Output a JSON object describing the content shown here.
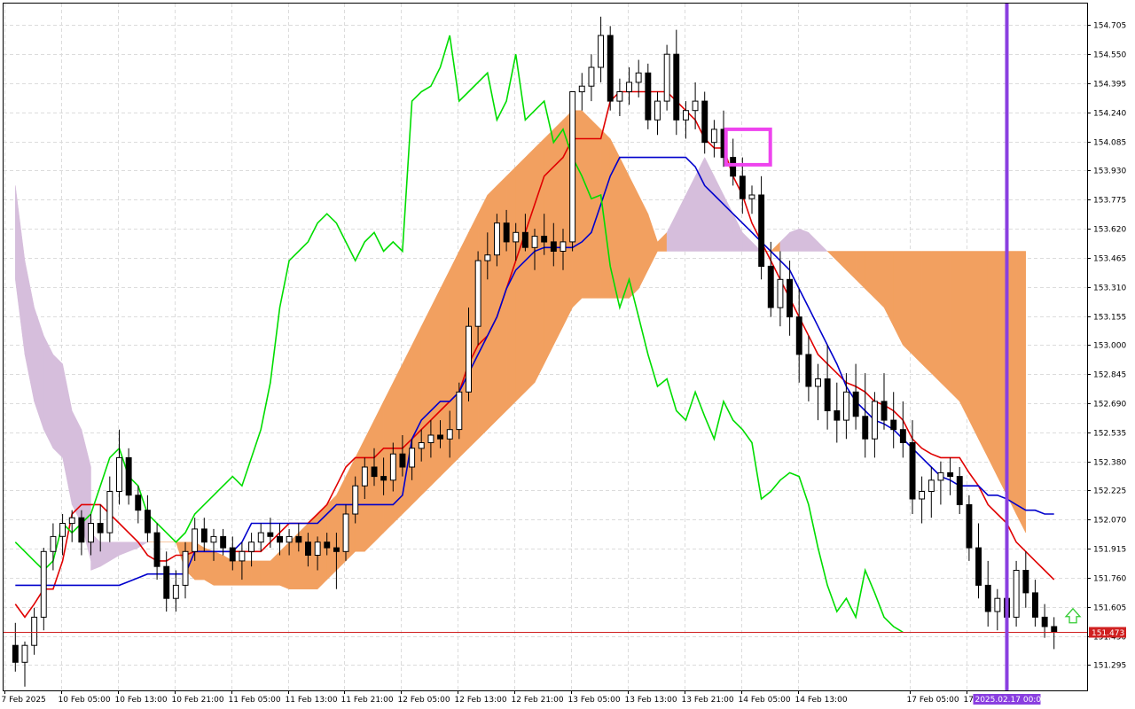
{
  "chart_data": {
    "type": "candlestick",
    "indicator": "Ichimoku Kinko Hyo",
    "grid": true,
    "ylim": [
      151.16,
      154.82
    ],
    "y_ticks": [
      "154.705",
      "154.550",
      "154.395",
      "154.240",
      "154.085",
      "153.930",
      "153.775",
      "153.620",
      "153.465",
      "153.310",
      "153.155",
      "153.000",
      "152.845",
      "152.690",
      "152.535",
      "152.380",
      "152.225",
      "152.070",
      "151.915",
      "151.760",
      "151.605",
      "151.450",
      "151.295"
    ],
    "x_ticks": [
      "7 Feb 2025",
      "10 Feb 05:00",
      "10 Feb 13:00",
      "10 Feb 21:00",
      "11 Feb 05:00",
      "11 Feb 13:00",
      "11 Feb 21:00",
      "12 Feb 05:00",
      "12 Feb 13:00",
      "12 Feb 21:00",
      "13 Feb 05:00",
      "13 Feb 13:00",
      "13 Feb 21:00",
      "14 Feb 05:00",
      "14 Feb 13:00",
      "17 Feb 05:00",
      "17 Feb 13:00"
    ],
    "current_price": "151.473",
    "vline_label": "2025.02.17 00:00",
    "ohlc": [
      [
        151.4,
        151.52,
        151.26,
        151.31
      ],
      [
        151.31,
        151.42,
        151.18,
        151.4
      ],
      [
        151.4,
        151.6,
        151.35,
        151.55
      ],
      [
        151.55,
        151.92,
        151.48,
        151.9
      ],
      [
        151.9,
        152.05,
        151.8,
        151.98
      ],
      [
        151.98,
        152.1,
        151.88,
        152.05
      ],
      [
        152.05,
        152.12,
        151.95,
        152.08
      ],
      [
        152.08,
        152.12,
        151.88,
        151.95
      ],
      [
        151.95,
        152.1,
        151.88,
        152.05
      ],
      [
        152.05,
        152.15,
        151.9,
        152.0
      ],
      [
        152.0,
        152.3,
        151.95,
        152.22
      ],
      [
        152.22,
        152.55,
        152.15,
        152.4
      ],
      [
        152.4,
        152.45,
        152.15,
        152.2
      ],
      [
        152.2,
        152.25,
        152.05,
        152.12
      ],
      [
        152.12,
        152.2,
        151.95,
        152.0
      ],
      [
        152.0,
        152.05,
        151.75,
        151.82
      ],
      [
        151.82,
        151.9,
        151.58,
        151.65
      ],
      [
        151.65,
        151.8,
        151.58,
        151.72
      ],
      [
        151.72,
        151.95,
        151.65,
        151.9
      ],
      [
        151.9,
        152.08,
        151.85,
        152.02
      ],
      [
        152.02,
        152.08,
        151.9,
        151.95
      ],
      [
        151.95,
        152.02,
        151.85,
        151.98
      ],
      [
        151.98,
        152.02,
        151.88,
        151.92
      ],
      [
        151.92,
        151.98,
        151.8,
        151.85
      ],
      [
        151.85,
        151.95,
        151.75,
        151.9
      ],
      [
        151.9,
        152.0,
        151.82,
        151.95
      ],
      [
        151.95,
        152.05,
        151.9,
        152.0
      ],
      [
        152.0,
        152.08,
        151.92,
        151.98
      ],
      [
        151.98,
        152.05,
        151.88,
        151.95
      ],
      [
        151.95,
        152.02,
        151.88,
        151.98
      ],
      [
        151.98,
        152.05,
        151.9,
        151.95
      ],
      [
        151.95,
        152.0,
        151.82,
        151.88
      ],
      [
        151.88,
        151.98,
        151.8,
        151.95
      ],
      [
        151.95,
        152.0,
        151.88,
        151.92
      ],
      [
        151.92,
        152.0,
        151.7,
        151.9
      ],
      [
        151.9,
        152.15,
        151.85,
        152.1
      ],
      [
        152.1,
        152.3,
        152.05,
        152.25
      ],
      [
        152.25,
        152.4,
        152.18,
        152.35
      ],
      [
        152.35,
        152.45,
        152.25,
        152.3
      ],
      [
        152.3,
        152.4,
        152.2,
        152.28
      ],
      [
        152.28,
        152.48,
        152.22,
        152.42
      ],
      [
        152.42,
        152.52,
        152.3,
        152.35
      ],
      [
        152.35,
        152.5,
        152.28,
        152.45
      ],
      [
        152.45,
        152.55,
        152.38,
        152.48
      ],
      [
        152.48,
        152.6,
        152.4,
        152.52
      ],
      [
        152.52,
        152.6,
        152.45,
        152.5
      ],
      [
        152.5,
        152.65,
        152.4,
        152.55
      ],
      [
        152.55,
        152.8,
        152.5,
        152.75
      ],
      [
        152.75,
        153.2,
        152.7,
        153.1
      ],
      [
        153.1,
        153.5,
        153.0,
        153.45
      ],
      [
        153.45,
        153.6,
        153.35,
        153.48
      ],
      [
        153.48,
        153.7,
        153.42,
        153.65
      ],
      [
        153.65,
        153.72,
        153.5,
        153.55
      ],
      [
        153.55,
        153.65,
        153.45,
        153.6
      ],
      [
        153.6,
        153.7,
        153.5,
        153.52
      ],
      [
        153.52,
        153.62,
        153.4,
        153.58
      ],
      [
        153.58,
        153.7,
        153.48,
        153.55
      ],
      [
        153.55,
        153.65,
        153.42,
        153.5
      ],
      [
        153.5,
        153.62,
        153.4,
        153.55
      ],
      [
        153.55,
        154.2,
        153.5,
        154.35
      ],
      [
        154.35,
        154.45,
        154.25,
        154.38
      ],
      [
        154.38,
        154.55,
        154.3,
        154.48
      ],
      [
        154.48,
        154.75,
        154.4,
        154.65
      ],
      [
        154.65,
        154.7,
        154.25,
        154.3
      ],
      [
        154.3,
        154.42,
        154.22,
        154.35
      ],
      [
        154.35,
        154.48,
        154.28,
        154.4
      ],
      [
        154.4,
        154.52,
        154.32,
        154.45
      ],
      [
        154.45,
        154.5,
        154.15,
        154.2
      ],
      [
        154.2,
        154.35,
        154.12,
        154.3
      ],
      [
        154.3,
        154.6,
        154.25,
        154.55
      ],
      [
        154.55,
        154.68,
        154.12,
        154.2
      ],
      [
        154.2,
        154.3,
        154.1,
        154.25
      ],
      [
        154.25,
        154.4,
        154.15,
        154.3
      ],
      [
        154.3,
        154.35,
        154.02,
        154.08
      ],
      [
        154.08,
        154.2,
        154.0,
        154.15
      ],
      [
        154.15,
        154.25,
        153.95,
        154.0
      ],
      [
        154.0,
        154.1,
        153.85,
        153.9
      ],
      [
        153.9,
        154.0,
        153.7,
        153.78
      ],
      [
        153.78,
        153.85,
        153.7,
        153.8
      ],
      [
        153.8,
        153.9,
        153.35,
        153.42
      ],
      [
        153.42,
        153.55,
        153.15,
        153.2
      ],
      [
        153.2,
        153.5,
        153.1,
        153.35
      ],
      [
        153.35,
        153.45,
        153.05,
        153.15
      ],
      [
        153.15,
        153.3,
        152.8,
        152.95
      ],
      [
        152.95,
        153.05,
        152.7,
        152.78
      ],
      [
        152.78,
        152.9,
        152.6,
        152.82
      ],
      [
        152.82,
        153.0,
        152.55,
        152.65
      ],
      [
        152.65,
        152.8,
        152.48,
        152.6
      ],
      [
        152.6,
        152.85,
        152.5,
        152.75
      ],
      [
        152.75,
        152.9,
        152.55,
        152.62
      ],
      [
        152.62,
        152.85,
        152.4,
        152.5
      ],
      [
        152.5,
        152.75,
        152.4,
        152.7
      ],
      [
        152.7,
        152.85,
        152.55,
        152.6
      ],
      [
        152.6,
        152.75,
        152.45,
        152.55
      ],
      [
        152.55,
        152.7,
        152.4,
        152.48
      ],
      [
        152.48,
        152.6,
        152.1,
        152.18
      ],
      [
        152.18,
        152.3,
        152.05,
        152.22
      ],
      [
        152.22,
        152.35,
        152.08,
        152.28
      ],
      [
        152.28,
        152.38,
        152.15,
        152.32
      ],
      [
        152.32,
        152.4,
        152.2,
        152.3
      ],
      [
        152.3,
        152.35,
        152.1,
        152.15
      ],
      [
        152.15,
        152.2,
        151.85,
        151.92
      ],
      [
        151.92,
        152.05,
        151.65,
        151.72
      ],
      [
        151.72,
        151.85,
        151.5,
        151.58
      ],
      [
        151.58,
        151.7,
        151.48,
        151.65
      ],
      [
        151.65,
        151.75,
        151.5,
        151.55
      ],
      [
        151.55,
        151.85,
        151.5,
        151.8
      ],
      [
        151.8,
        151.9,
        151.6,
        151.68
      ],
      [
        151.68,
        151.75,
        151.5,
        151.55
      ],
      [
        151.55,
        151.62,
        151.44,
        151.5
      ],
      [
        151.5,
        151.55,
        151.38,
        151.47
      ]
    ],
    "series": [
      {
        "name": "Tenkan-sen",
        "color": "#e00000",
        "start": 0,
        "values": [
          151.62,
          151.55,
          151.62,
          151.7,
          151.7,
          151.85,
          152.1,
          152.15,
          152.15,
          152.15,
          152.1,
          152.05,
          152.0,
          151.95,
          151.88,
          151.85,
          151.85,
          151.88,
          151.88,
          151.9,
          151.9,
          151.9,
          151.9,
          151.9,
          151.9,
          151.9,
          151.9,
          151.95,
          152.0,
          152.05,
          152.05,
          152.05,
          152.1,
          152.15,
          152.25,
          152.35,
          152.4,
          152.4,
          152.4,
          152.45,
          152.45,
          152.45,
          152.5,
          152.55,
          152.6,
          152.65,
          152.7,
          152.75,
          152.9,
          153.0,
          153.05,
          153.15,
          153.3,
          153.45,
          153.6,
          153.75,
          153.9,
          153.95,
          154.0,
          154.1,
          154.1,
          154.1,
          154.1,
          154.3,
          154.35,
          154.35,
          154.35,
          154.35,
          154.35,
          154.35,
          154.3,
          154.25,
          154.2,
          154.1,
          154.05,
          154.05,
          153.9,
          153.8,
          153.65,
          153.55,
          153.45,
          153.35,
          153.25,
          153.15,
          153.05,
          152.95,
          152.9,
          152.85,
          152.8,
          152.78,
          152.75,
          152.7,
          152.68,
          152.65,
          152.6,
          152.5,
          152.45,
          152.42,
          152.4,
          152.4,
          152.4,
          152.32,
          152.25,
          152.15,
          152.1,
          152.05,
          151.95,
          151.9,
          151.85,
          151.8,
          151.75
        ]
      },
      {
        "name": "Kijun-sen",
        "color": "#0000cc",
        "start": 0,
        "values": [
          151.72,
          151.72,
          151.72,
          151.72,
          151.72,
          151.72,
          151.72,
          151.72,
          151.72,
          151.72,
          151.72,
          151.72,
          151.74,
          151.76,
          151.78,
          151.78,
          151.78,
          151.78,
          151.78,
          151.9,
          151.9,
          151.9,
          151.9,
          151.9,
          151.95,
          152.05,
          152.05,
          152.05,
          152.05,
          152.05,
          152.05,
          152.05,
          152.05,
          152.1,
          152.15,
          152.15,
          152.15,
          152.15,
          152.15,
          152.15,
          152.15,
          152.2,
          152.5,
          152.6,
          152.65,
          152.7,
          152.7,
          152.75,
          152.85,
          152.95,
          153.05,
          153.15,
          153.3,
          153.4,
          153.45,
          153.5,
          153.52,
          153.52,
          153.52,
          153.52,
          153.55,
          153.6,
          153.75,
          153.9,
          154.0,
          154.0,
          154.0,
          154.0,
          154.0,
          154.0,
          154.0,
          154.0,
          153.95,
          153.85,
          153.8,
          153.75,
          153.7,
          153.65,
          153.6,
          153.55,
          153.5,
          153.45,
          153.4,
          153.3,
          153.2,
          153.1,
          153.0,
          152.9,
          152.78,
          152.7,
          152.65,
          152.6,
          152.58,
          152.55,
          152.5,
          152.45,
          152.4,
          152.35,
          152.3,
          152.28,
          152.25,
          152.25,
          152.25,
          152.2,
          152.2,
          152.18,
          152.15,
          152.12,
          152.12,
          152.1,
          152.1
        ]
      },
      {
        "name": "Chikou Span",
        "color": "#00dd00",
        "start": 0,
        "values": [
          151.95,
          151.9,
          151.85,
          151.8,
          151.85,
          152.05,
          152.0,
          152.05,
          152.1,
          152.25,
          152.4,
          152.45,
          152.3,
          152.25,
          152.1,
          152.05,
          152.0,
          151.95,
          152.0,
          152.1,
          152.15,
          152.2,
          152.25,
          152.3,
          152.25,
          152.4,
          152.55,
          152.8,
          153.2,
          153.45,
          153.5,
          153.55,
          153.65,
          153.7,
          153.65,
          153.55,
          153.45,
          153.55,
          153.6,
          153.5,
          153.55,
          153.5,
          154.3,
          154.35,
          154.38,
          154.48,
          154.65,
          154.3,
          154.35,
          154.4,
          154.45,
          154.2,
          154.3,
          154.55,
          154.2,
          154.25,
          154.3,
          154.08,
          154.15,
          154.0,
          153.9,
          153.78,
          153.8,
          153.42,
          153.2,
          153.35,
          153.15,
          152.95,
          152.78,
          152.82,
          152.65,
          152.6,
          152.75,
          152.62,
          152.5,
          152.7,
          152.6,
          152.55,
          152.48,
          152.18,
          152.22,
          152.28,
          152.32,
          152.3,
          152.15,
          151.92,
          151.72,
          151.58,
          151.65,
          151.55,
          151.8,
          151.68,
          151.55,
          151.5,
          151.47
        ]
      },
      {
        "name": "Senkou Span A",
        "color": "#f2a060",
        "start": 8,
        "values": [
          151.8,
          151.82,
          151.85,
          151.88,
          151.9,
          151.92,
          151.95,
          151.95,
          151.95,
          151.95,
          151.95,
          151.95,
          151.92,
          151.9,
          151.88,
          151.85,
          151.85,
          151.85,
          151.85,
          151.85,
          151.9,
          151.95,
          152.0,
          152.05,
          152.1,
          152.15,
          152.2,
          152.3,
          152.4,
          152.5,
          152.6,
          152.7,
          152.8,
          152.9,
          153.0,
          153.1,
          153.2,
          153.3,
          153.4,
          153.5,
          153.6,
          153.7,
          153.8,
          153.85,
          153.9,
          153.95,
          154.0,
          154.05,
          154.1,
          154.15,
          154.2,
          154.25,
          154.25,
          154.2,
          154.15,
          154.1,
          154.0,
          153.9,
          153.8,
          153.7,
          153.55,
          153.5,
          153.5,
          153.5
        ]
      },
      {
        "name": "Senkou Span B",
        "color": "#c0a0c8",
        "start": 0,
        "values": [
          153.5,
          153.1,
          152.85,
          152.7,
          152.6,
          152.55,
          152.3,
          152.2,
          152.0,
          151.95,
          151.95,
          151.95,
          151.95,
          151.95,
          151.95,
          151.95,
          151.95,
          151.95,
          151.8,
          151.75,
          151.75,
          151.72,
          151.72,
          151.72,
          151.72,
          151.72,
          151.72,
          151.72,
          151.72,
          151.7,
          151.7,
          151.7,
          151.7,
          151.75,
          151.8,
          151.85,
          151.9,
          151.9,
          151.95,
          152.0,
          152.05,
          152.1,
          152.15,
          152.2,
          152.25,
          152.3,
          152.35,
          152.4,
          152.45,
          152.5,
          152.55,
          152.6,
          152.65,
          152.7,
          152.75,
          152.8,
          152.9,
          153.0,
          153.1,
          153.2,
          153.25,
          153.25,
          153.25,
          153.25,
          153.25,
          153.25,
          153.3,
          153.4,
          153.5,
          153.6,
          153.7,
          153.8,
          153.9,
          154.0,
          153.9,
          153.8,
          153.7,
          153.6,
          153.55,
          153.5,
          153.5,
          153.55,
          153.6,
          153.62,
          153.6,
          153.55,
          153.5,
          153.45,
          153.4,
          153.35,
          153.3,
          153.25,
          153.2,
          153.1,
          153.0,
          152.95,
          152.9,
          152.85,
          152.8,
          152.75,
          152.7,
          152.6,
          152.5,
          152.4,
          152.3,
          152.2,
          152.1,
          152.0
        ]
      }
    ]
  },
  "icons": {
    "signal_arrow": "up-arrow-icon",
    "highlight_box": "crossover-highlight-box"
  }
}
